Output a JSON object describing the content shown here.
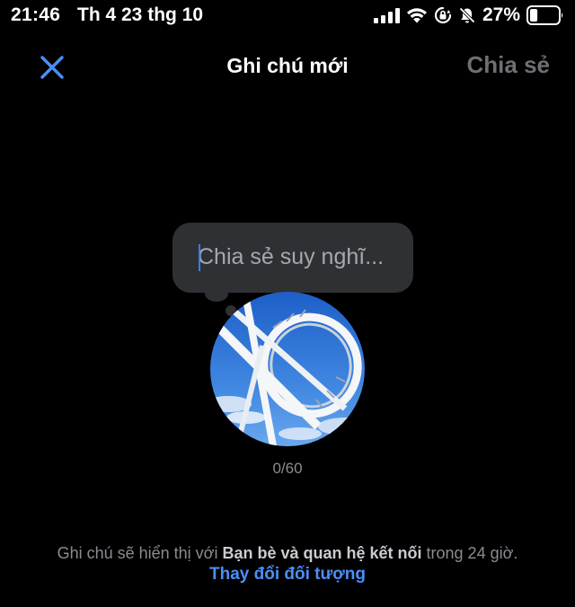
{
  "status_bar": {
    "time": "21:46",
    "date": "Th 4 23 thg 10",
    "battery_percent": "27%",
    "battery_level": 0.27,
    "icons": [
      "signal-icon",
      "wifi-icon",
      "lock-rotation-icon",
      "silent-icon",
      "battery-icon"
    ]
  },
  "header": {
    "title": "Ghi chú mới",
    "share_label": "Chia sẻ",
    "close_icon": "close-icon"
  },
  "note": {
    "value": "",
    "placeholder": "Chia sẻ suy nghĩ..."
  },
  "counter": {
    "text": "0/60"
  },
  "footer": {
    "prefix": "Ghi chú sẽ hiển thị với ",
    "audience": "Bạn bè và quan hệ kết nối",
    "suffix": " trong 24 giờ.",
    "change_audience_label": "Thay đổi đối tượng"
  },
  "colors": {
    "background": "#000000",
    "accent": "#4b8ff7",
    "bubble": "#2f3033",
    "muted_text": "#8a8c91",
    "share_disabled": "#6d6f74"
  }
}
